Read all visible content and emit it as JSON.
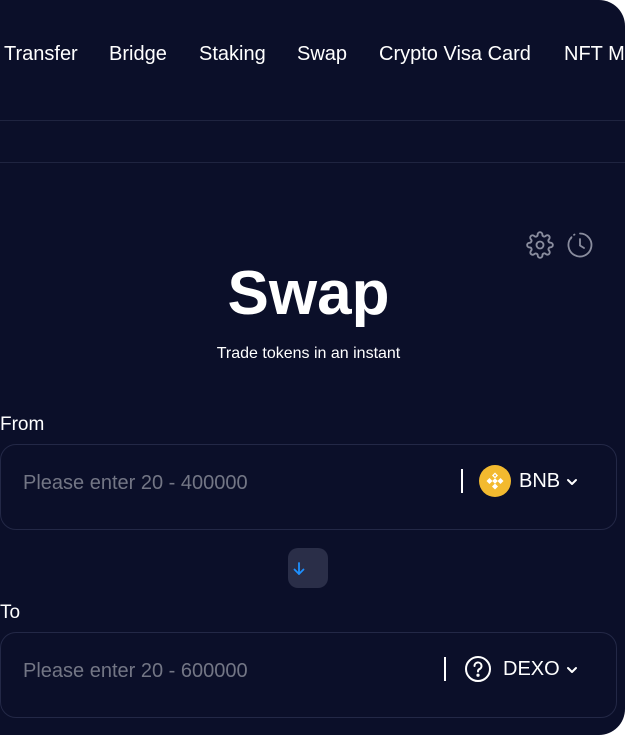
{
  "nav": {
    "items": [
      {
        "label": "Transfer"
      },
      {
        "label": "Bridge"
      },
      {
        "label": "Staking"
      },
      {
        "label": "Swap"
      },
      {
        "label": "Crypto Visa Card"
      },
      {
        "label": "NFT M"
      }
    ]
  },
  "toolbar": {
    "settings_icon": "gear-icon",
    "history_icon": "clock-history-icon"
  },
  "swap": {
    "title": "Swap",
    "subtitle": "Trade tokens in an instant",
    "from": {
      "label": "From",
      "placeholder": "Please enter 20 - 400000",
      "value": "",
      "token": "BNB",
      "token_icon": "bnb-icon"
    },
    "switch_icon": "arrow-down-icon",
    "to": {
      "label": "To",
      "placeholder": "Please enter 20 - 600000",
      "value": "",
      "token": "DEXO",
      "token_icon": "question-circle-icon"
    }
  },
  "colors": {
    "background": "#0b0f29",
    "border": "#232846",
    "bnb": "#f3ba2f",
    "accent": "#1e90ff"
  }
}
